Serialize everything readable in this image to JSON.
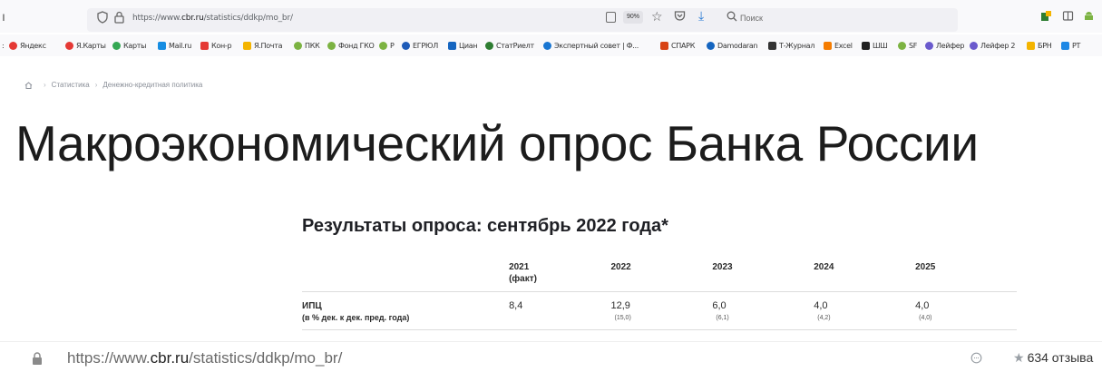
{
  "browser": {
    "url_prefix": "https://www.",
    "url_domain": "cbr.ru",
    "url_path": "/statistics/ddkp/mo_br/",
    "zoom": "90%",
    "search_placeholder": "Поиск"
  },
  "bookmarks": [
    {
      "label": "Яндекс",
      "color": "#e53935"
    },
    {
      "label": "Я.Карты",
      "color": "#e53935"
    },
    {
      "label": "Карты",
      "color": "#34a853"
    },
    {
      "label": "Mail.ru",
      "color": "#168de2"
    },
    {
      "label": "Кон-р",
      "color": "#e53935"
    },
    {
      "label": "Я.Почта",
      "color": "#f4b400"
    },
    {
      "label": "ПКК",
      "color": "#7cb342"
    },
    {
      "label": "Фонд ГКО",
      "color": "#7cb342"
    },
    {
      "label": "Р",
      "color": "#7cb342"
    },
    {
      "label": "ЕГРЮЛ",
      "color": "#1e5bb8"
    },
    {
      "label": "Циан",
      "color": "#1565c0"
    },
    {
      "label": "СтатРиелт",
      "color": "#2e7d32"
    },
    {
      "label": "Экспертный совет | Ф...",
      "color": "#1976d2"
    },
    {
      "label": "СПАРК",
      "color": "#d84315"
    },
    {
      "label": "Damodaran",
      "color": "#1565c0"
    },
    {
      "label": "Т-Журнал",
      "color": "#333333"
    },
    {
      "label": "Excel",
      "color": "#f57c00"
    },
    {
      "label": "ШШ",
      "color": "#212121"
    },
    {
      "label": "SF",
      "color": "#7cb342"
    },
    {
      "label": "Лейфер",
      "color": "#6a5acd"
    },
    {
      "label": "Лейфер 2",
      "color": "#6a5acd"
    },
    {
      "label": "БРН",
      "color": "#f4b400"
    },
    {
      "label": "PT",
      "color": "#1e88e5"
    }
  ],
  "breadcrumb": {
    "items": [
      "Статистика",
      "Денежно-кредитная политика"
    ]
  },
  "page": {
    "title": "Макроэкономический опрос Банка России",
    "section_title": "Результаты опроса: сентябрь 2022 года*"
  },
  "table": {
    "headers": [
      {
        "line1": "2021",
        "line2": "(факт)"
      },
      {
        "line1": "2022",
        "line2": ""
      },
      {
        "line1": "2023",
        "line2": ""
      },
      {
        "line1": "2024",
        "line2": ""
      },
      {
        "line1": "2025",
        "line2": ""
      }
    ],
    "rows": [
      {
        "label": "ИПЦ",
        "unit": "(в % дек. к дек. пред. года)",
        "cells": [
          {
            "value": "8,4",
            "prev": ""
          },
          {
            "value": "12,9",
            "prev": "(15,0)"
          },
          {
            "value": "6,0",
            "prev": "(6,1)"
          },
          {
            "value": "4,0",
            "prev": "(4,2)"
          },
          {
            "value": "4,0",
            "prev": "(4,0)"
          }
        ]
      }
    ]
  },
  "statusbar": {
    "url_prefix": "https://www.",
    "url_domain": "cbr.ru",
    "url_path": "/statistics/ddkp/mo_br/",
    "rating": "634 отзыва"
  }
}
